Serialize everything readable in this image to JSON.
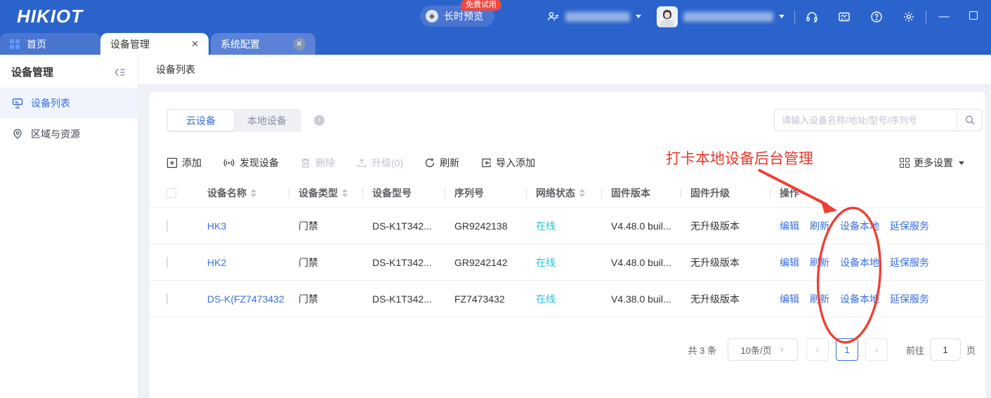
{
  "colors": {
    "header_blue": "#2b63cc",
    "link_blue": "#3a6fdc",
    "status_online": "#2bc2de",
    "annotation_red": "#e8382c",
    "disabled_gray": "#c0c4cc"
  },
  "header": {
    "logo": "HIKIOT",
    "trial_badge": "免费试用",
    "preview_button": "长时预览"
  },
  "window_tabs": {
    "home": "首页",
    "device_mgmt": "设备管理",
    "system_config": "系统配置"
  },
  "sidebar": {
    "title": "设备管理",
    "items": [
      {
        "label": "设备列表",
        "active": true
      },
      {
        "label": "区域与资源",
        "active": false
      }
    ]
  },
  "page": {
    "title": "设备列表"
  },
  "device_tabs": {
    "cloud": "云设备",
    "local": "本地设备"
  },
  "search": {
    "placeholder": "请输入设备名称/地址/型号/序列号"
  },
  "toolbar": {
    "add": "添加",
    "discover": "发现设备",
    "delete": "删除",
    "upgrade": "升级(0)",
    "refresh": "刷新",
    "import": "导入添加",
    "more_settings": "更多设置"
  },
  "annotation": {
    "text": "打卡本地设备后台管理"
  },
  "table": {
    "headers": {
      "name": "设备名称",
      "type": "设备类型",
      "model": "设备型号",
      "serial": "序列号",
      "network": "网络状态",
      "firmware": "固件版本",
      "upgrade": "固件升级",
      "operation": "操作"
    },
    "actions": {
      "edit": "编辑",
      "refresh": "刷新",
      "local": "设备本地",
      "warranty": "延保服务"
    },
    "rows": [
      {
        "name": "HK3",
        "type": "门禁",
        "model": "DS-K1T342...",
        "serial": "GR9242138",
        "status": "在线",
        "firmware": "V4.48.0 buil...",
        "upgrade": "无升级版本"
      },
      {
        "name": "HK2",
        "type": "门禁",
        "model": "DS-K1T342...",
        "serial": "GR9242142",
        "status": "在线",
        "firmware": "V4.48.0 buil...",
        "upgrade": "无升级版本"
      },
      {
        "name": "DS-K(FZ7473432",
        "type": "门禁",
        "model": "DS-K1T342...",
        "serial": "FZ7473432",
        "status": "在线",
        "firmware": "V4.38.0 buil...",
        "upgrade": "无升级版本"
      }
    ]
  },
  "pagination": {
    "total": "共 3 条",
    "page_size": "10条/页",
    "current_page": "1",
    "goto_label": "前往",
    "goto_value": "1",
    "goto_suffix": "页"
  }
}
